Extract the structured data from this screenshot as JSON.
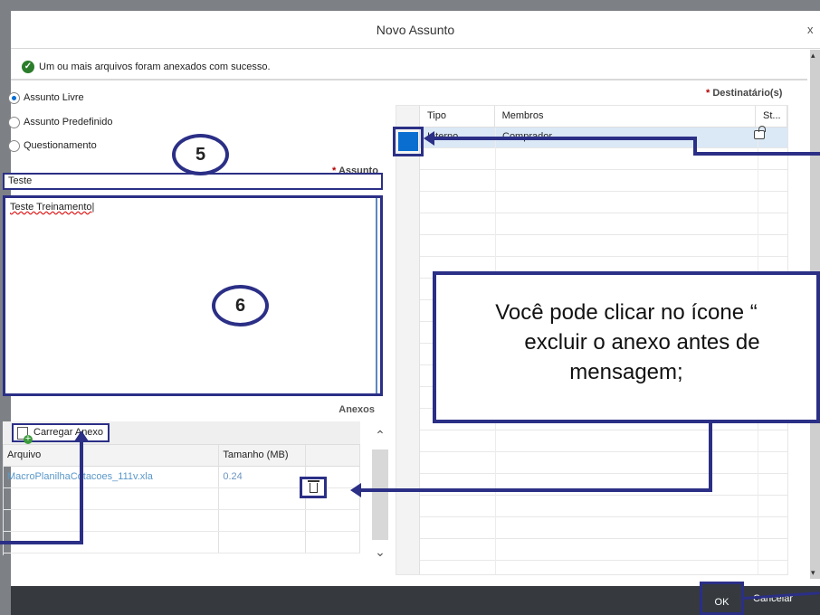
{
  "dialog": {
    "title": "Novo Assunto",
    "close_label": "x",
    "success_message": "Um ou mais arquivos foram anexados com sucesso."
  },
  "subject_types": [
    {
      "label": "Assunto Livre",
      "checked": true
    },
    {
      "label": "Assunto Predefinido",
      "checked": false
    },
    {
      "label": "Questionamento",
      "checked": false
    }
  ],
  "subject": {
    "required_mark": "*",
    "label": "Assunto",
    "value": "Teste"
  },
  "body_text": "Teste Treinamento",
  "attachments": {
    "section_label": "Anexos",
    "upload_button": "Carregar Anexo",
    "columns": [
      "Arquivo",
      "Tamanho (MB)"
    ],
    "rows": [
      {
        "file": "MacroPlanilhaCotacoes_111v.xla",
        "size": "0.24"
      }
    ]
  },
  "recipients": {
    "required_mark": "*",
    "label": "Destinatário(s)",
    "columns": [
      "Tipo",
      "Membros",
      "St..."
    ],
    "rows": [
      {
        "tipo": "Interno",
        "membros": "Comprador"
      }
    ]
  },
  "footer": {
    "ok_label": "OK",
    "cancel_label": "Cancelar"
  },
  "overlay": {
    "badge_5": "5",
    "badge_6": "6",
    "callout_line1": "Você pode clicar no ícone “",
    "callout_line2": "excluir o anexo antes de",
    "callout_line3": "mensagem;"
  },
  "colors": {
    "annotation": "#2b2f86",
    "accent": "#0a6ed1",
    "footer_bg": "#363a3f",
    "success": "#2b7d2b"
  }
}
